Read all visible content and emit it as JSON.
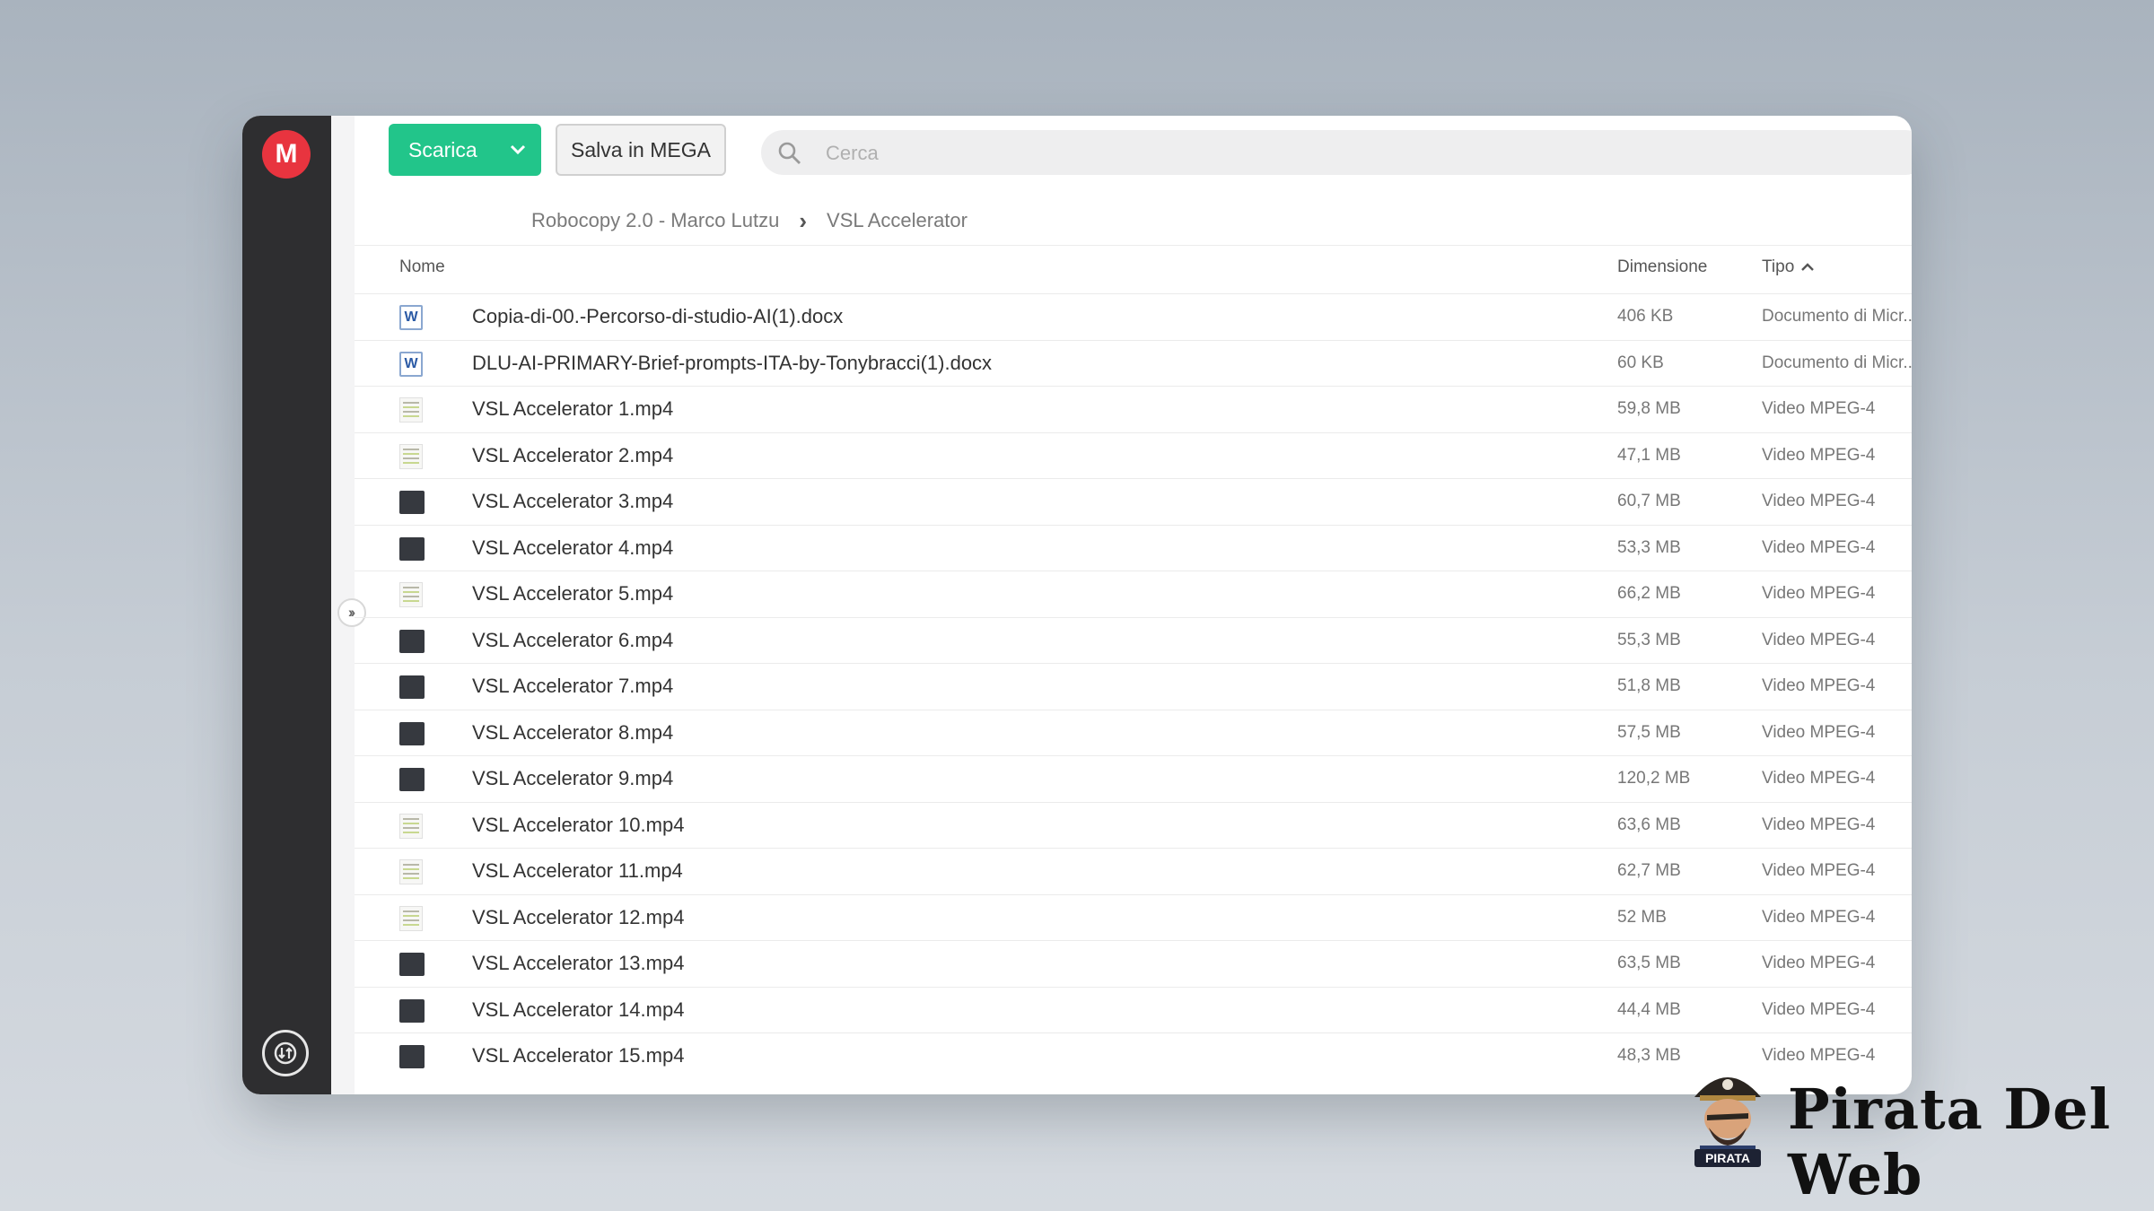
{
  "toolbar": {
    "download_label": "Scarica",
    "save_label": "Salva in MEGA",
    "search_placeholder": "Cerca"
  },
  "breadcrumb": {
    "parent": "Robocopy 2.0 - Marco Lutzu",
    "current": "VSL Accelerator"
  },
  "columns": {
    "name": "Nome",
    "size": "Dimensione",
    "type": "Tipo"
  },
  "files": [
    {
      "name": "Copia-di-00.-Percorso-di-studio-AI(1).docx",
      "size": "406 KB",
      "type": "Documento di Micr...",
      "icon": "word-icon"
    },
    {
      "name": "DLU-AI-PRIMARY-Brief-prompts-ITA-by-Tonybracci(1).docx",
      "size": "60 KB",
      "type": "Documento di Micr...",
      "icon": "word-icon"
    },
    {
      "name": "VSL Accelerator 1.mp4",
      "size": "59,8 MB",
      "type": "Video MPEG-4",
      "icon": "video-thumb-light"
    },
    {
      "name": "VSL Accelerator 2.mp4",
      "size": "47,1 MB",
      "type": "Video MPEG-4",
      "icon": "video-thumb-light"
    },
    {
      "name": "VSL Accelerator 3.mp4",
      "size": "60,7 MB",
      "type": "Video MPEG-4",
      "icon": "video-thumb-dark"
    },
    {
      "name": "VSL Accelerator 4.mp4",
      "size": "53,3 MB",
      "type": "Video MPEG-4",
      "icon": "video-thumb-dark"
    },
    {
      "name": "VSL Accelerator 5.mp4",
      "size": "66,2 MB",
      "type": "Video MPEG-4",
      "icon": "video-thumb-light"
    },
    {
      "name": "VSL Accelerator 6.mp4",
      "size": "55,3 MB",
      "type": "Video MPEG-4",
      "icon": "video-thumb-dark"
    },
    {
      "name": "VSL Accelerator 7.mp4",
      "size": "51,8 MB",
      "type": "Video MPEG-4",
      "icon": "video-thumb-dark"
    },
    {
      "name": "VSL Accelerator 8.mp4",
      "size": "57,5 MB",
      "type": "Video MPEG-4",
      "icon": "video-thumb-dark"
    },
    {
      "name": "VSL Accelerator 9.mp4",
      "size": "120,2 MB",
      "type": "Video MPEG-4",
      "icon": "video-thumb-dark"
    },
    {
      "name": "VSL Accelerator 10.mp4",
      "size": "63,6 MB",
      "type": "Video MPEG-4",
      "icon": "video-thumb-light"
    },
    {
      "name": "VSL Accelerator 11.mp4",
      "size": "62,7 MB",
      "type": "Video MPEG-4",
      "icon": "video-thumb-light"
    },
    {
      "name": "VSL Accelerator 12.mp4",
      "size": "52 MB",
      "type": "Video MPEG-4",
      "icon": "video-thumb-light"
    },
    {
      "name": "VSL Accelerator 13.mp4",
      "size": "63,5 MB",
      "type": "Video MPEG-4",
      "icon": "video-thumb-dark"
    },
    {
      "name": "VSL Accelerator 14.mp4",
      "size": "44,4 MB",
      "type": "Video MPEG-4",
      "icon": "video-thumb-dark"
    },
    {
      "name": "VSL Accelerator 15.mp4",
      "size": "48,3 MB",
      "type": "Video MPEG-4",
      "icon": "video-thumb-dark"
    }
  ],
  "watermark": {
    "brand": "Pirata Del Web",
    "badge": "PIRATA"
  },
  "colors": {
    "download_green": "#22c58a",
    "mega_red": "#e8343f",
    "sidebar_dark": "#2e2e30"
  }
}
